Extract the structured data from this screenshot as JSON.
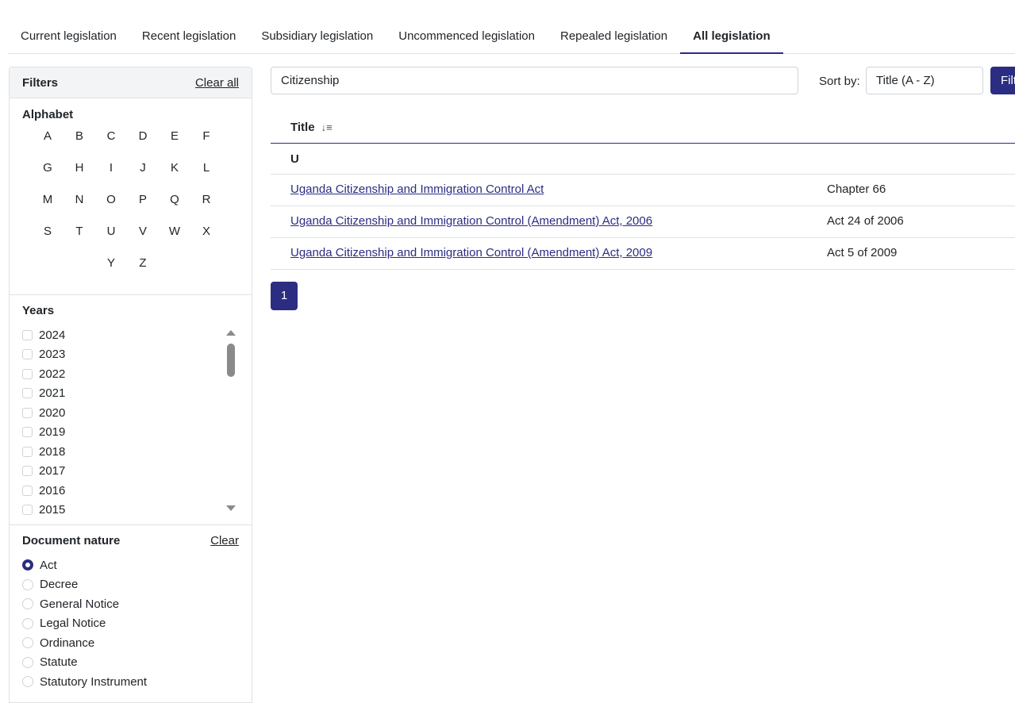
{
  "tabs": [
    {
      "label": "Current legislation"
    },
    {
      "label": "Recent legislation"
    },
    {
      "label": "Subsidiary legislation"
    },
    {
      "label": "Uncommenced legislation"
    },
    {
      "label": "Repealed legislation"
    },
    {
      "label": "All legislation",
      "active": true
    }
  ],
  "filters": {
    "title": "Filters",
    "clear_all": "Clear all",
    "alphabet": {
      "title": "Alphabet",
      "letters": [
        "A",
        "B",
        "C",
        "D",
        "E",
        "F",
        "G",
        "H",
        "I",
        "J",
        "K",
        "L",
        "M",
        "N",
        "O",
        "P",
        "Q",
        "R",
        "S",
        "T",
        "U",
        "V",
        "W",
        "X",
        "Y",
        "Z"
      ]
    },
    "years": {
      "title": "Years",
      "items": [
        "2024",
        "2023",
        "2022",
        "2021",
        "2020",
        "2019",
        "2018",
        "2017",
        "2016",
        "2015"
      ]
    },
    "nature": {
      "title": "Document nature",
      "clear": "Clear",
      "items": [
        "Act",
        "Decree",
        "General Notice",
        "Legal Notice",
        "Ordinance",
        "Statute",
        "Statutory Instrument"
      ],
      "selected": "Act"
    }
  },
  "search": {
    "value": "Citizenship"
  },
  "sort": {
    "label": "Sort by:",
    "value": "Title (A - Z)"
  },
  "filter_button": "Filter",
  "table": {
    "header": "Title",
    "group": "U",
    "rows": [
      {
        "title": "Uganda Citizenship and Immigration Control Act",
        "citation": "Chapter 66"
      },
      {
        "title": "Uganda Citizenship and Immigration Control (Amendment) Act, 2006",
        "citation": "Act 24 of 2006"
      },
      {
        "title": "Uganda Citizenship and Immigration Control (Amendment) Act, 2009",
        "citation": "Act 5 of 2009"
      }
    ]
  },
  "pagination": {
    "current": "1"
  },
  "colors": {
    "accent": "#2b2d82",
    "border": "#dee2e6"
  }
}
